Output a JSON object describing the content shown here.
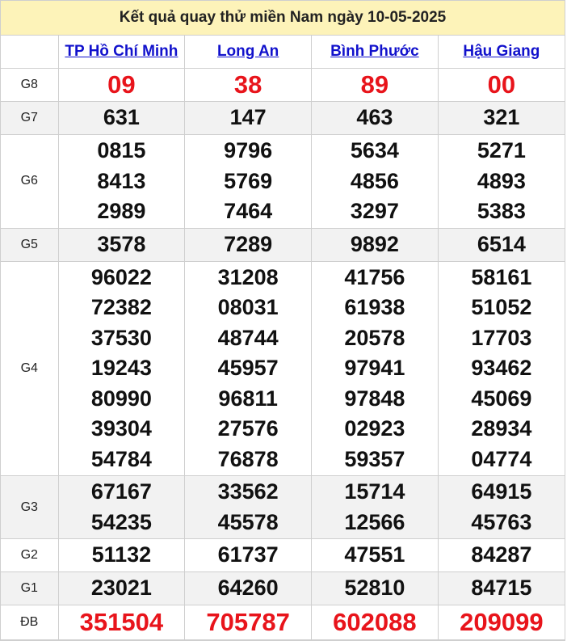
{
  "title": "Kết quả quay thử miền Nam ngày 10-05-2025",
  "provinces": [
    "TP Hồ Chí Minh",
    "Long An",
    "Bình Phước",
    "Hậu Giang"
  ],
  "prizes": [
    {
      "label": "G8",
      "values": [
        [
          "09"
        ],
        [
          "38"
        ],
        [
          "89"
        ],
        [
          "00"
        ]
      ]
    },
    {
      "label": "G7",
      "values": [
        [
          "631"
        ],
        [
          "147"
        ],
        [
          "463"
        ],
        [
          "321"
        ]
      ]
    },
    {
      "label": "G6",
      "values": [
        [
          "0815",
          "8413",
          "2989"
        ],
        [
          "9796",
          "5769",
          "7464"
        ],
        [
          "5634",
          "4856",
          "3297"
        ],
        [
          "5271",
          "4893",
          "5383"
        ]
      ]
    },
    {
      "label": "G5",
      "values": [
        [
          "3578"
        ],
        [
          "7289"
        ],
        [
          "9892"
        ],
        [
          "6514"
        ]
      ]
    },
    {
      "label": "G4",
      "values": [
        [
          "96022",
          "72382",
          "37530",
          "19243",
          "80990",
          "39304",
          "54784"
        ],
        [
          "31208",
          "08031",
          "48744",
          "45957",
          "96811",
          "27576",
          "76878"
        ],
        [
          "41756",
          "61938",
          "20578",
          "97941",
          "97848",
          "02923",
          "59357"
        ],
        [
          "58161",
          "51052",
          "17703",
          "93462",
          "45069",
          "28934",
          "04774"
        ]
      ]
    },
    {
      "label": "G3",
      "values": [
        [
          "67167",
          "54235"
        ],
        [
          "33562",
          "45578"
        ],
        [
          "15714",
          "12566"
        ],
        [
          "64915",
          "45763"
        ]
      ]
    },
    {
      "label": "G2",
      "values": [
        [
          "51132"
        ],
        [
          "61737"
        ],
        [
          "47551"
        ],
        [
          "84287"
        ]
      ]
    },
    {
      "label": "G1",
      "values": [
        [
          "23021"
        ],
        [
          "64260"
        ],
        [
          "52810"
        ],
        [
          "84715"
        ]
      ]
    },
    {
      "label": "ĐB",
      "values": [
        [
          "351504"
        ],
        [
          "705787"
        ],
        [
          "602088"
        ],
        [
          "209099"
        ]
      ]
    }
  ],
  "colors": {
    "header_bg": "#fdf3b9",
    "link": "#1111cc",
    "highlight": "#e8141b",
    "row_shade": "#f2f2f2"
  }
}
